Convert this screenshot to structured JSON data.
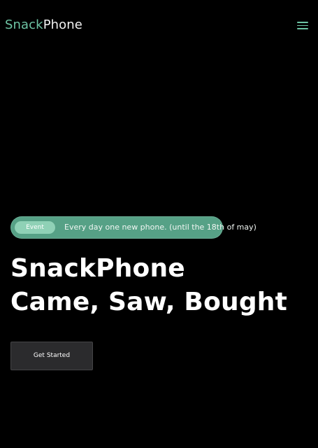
{
  "navbar": {
    "brand_accent": "Snack",
    "brand_main": "Phone",
    "menu_icon": "hamburger-menu-icon"
  },
  "hero": {
    "event_badge": "Event",
    "event_text": "Every day one new phone. (until the 18th of may)",
    "title_line_1": "SnackPhone",
    "title_line_2": "Came, Saw, Bought",
    "cta_label": "Get Started"
  },
  "colors": {
    "background": "#000000",
    "accent": "#6dc4a4",
    "pill": "#56a186",
    "badge": "#8fd1b6",
    "button": "#2b2b2d"
  }
}
